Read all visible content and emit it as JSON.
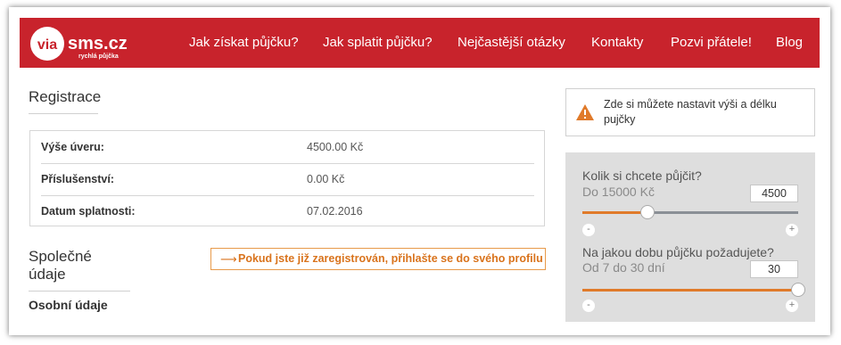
{
  "brand": {
    "logo_text": "viasms.cz",
    "logo_tagline": "rychlá půjčka",
    "color": "#c8232c",
    "accent": "#e07a2a"
  },
  "nav": {
    "items": [
      {
        "label": "Jak získat půjčku?"
      },
      {
        "label": "Jak splatit půjčku?"
      },
      {
        "label": "Nejčastější otázky"
      },
      {
        "label": "Kontakty"
      },
      {
        "label": "Pozvi přátele!"
      },
      {
        "label": "Blog"
      }
    ]
  },
  "registration": {
    "title": "Registrace",
    "rows": [
      {
        "label": "Výše úveru:",
        "value": "4500.00 Kč"
      },
      {
        "label": "Příslušenství:",
        "value": "0.00 Kč"
      },
      {
        "label": "Datum splatnosti:",
        "value": "07.02.2016"
      }
    ]
  },
  "shared": {
    "title": "Společné údaje",
    "login_hint_icon": "arrow-right-icon",
    "login_hint": "Pokud jste již zaregistrován, přihlašte se do svého profilu"
  },
  "personal": {
    "title": "Osobní údaje"
  },
  "notice": {
    "icon": "warning-icon",
    "text": "Zde si můžete nastavit výši a délku pujčky"
  },
  "calculator": {
    "amount": {
      "question": "Kolik si chcete půjčit?",
      "range": "Do 15000 Kč",
      "value": "4500",
      "level": 0.3,
      "minus": "-",
      "plus": "+"
    },
    "duration": {
      "question": "Na jakou dobu půjčku požadujete?",
      "range": "Od 7 do 30 dní",
      "value": "30",
      "level": 1.0,
      "minus": "-",
      "plus": "+"
    }
  }
}
